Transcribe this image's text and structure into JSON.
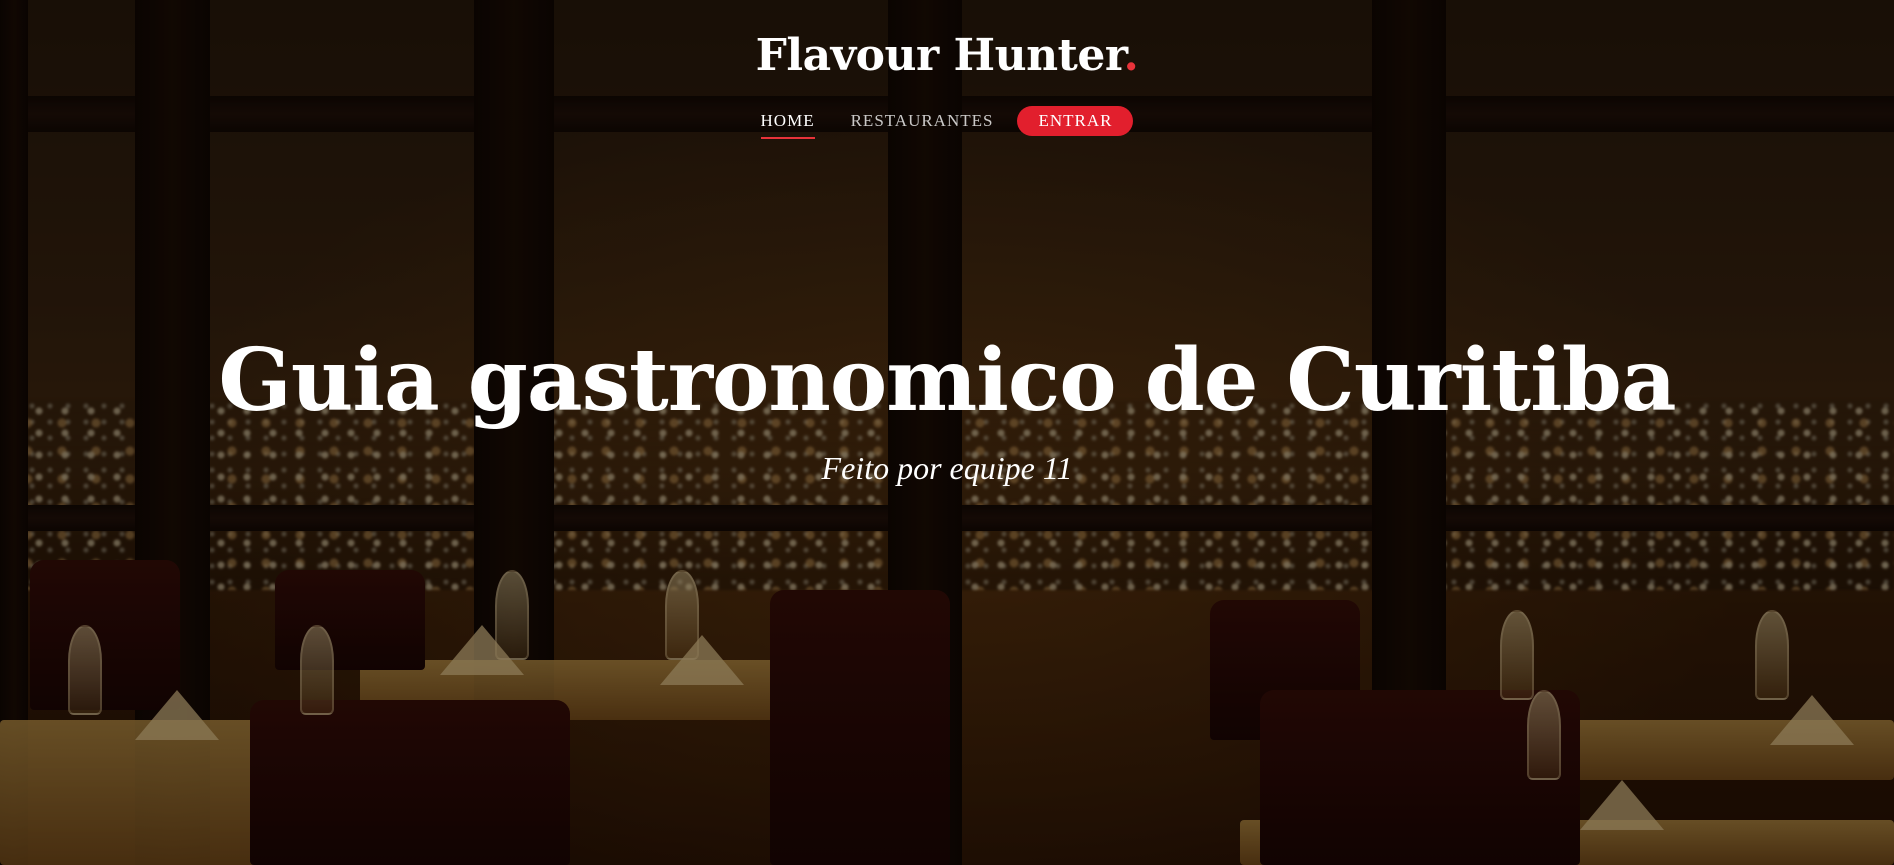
{
  "header": {
    "brand": "Flavour Hunter",
    "brand_dot": ".",
    "nav": {
      "home": "HOME",
      "restaurantes": "RESTAURANTES",
      "entrar": "ENTRAR"
    }
  },
  "hero": {
    "title": "Guia gastronomico de Curitiba",
    "subtitle": "Feito por equipe 11"
  },
  "colors": {
    "accent": "#e21f2d",
    "text": "#ffffff"
  }
}
